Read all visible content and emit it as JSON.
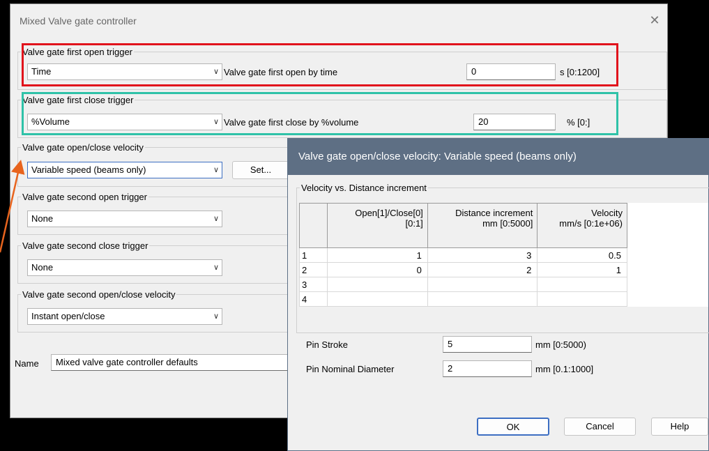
{
  "main_dialog": {
    "title": "Mixed Valve gate controller",
    "close_glyph": "✕",
    "groups": {
      "first_open": {
        "legend": "Valve gate first open trigger",
        "combo": "Time",
        "param_label": "Valve gate first open by time",
        "param_value": "0",
        "unit": "s [0:1200]"
      },
      "first_close": {
        "legend": "Valve gate first close trigger",
        "combo": "%Volume",
        "param_label": "Valve gate first close by %volume",
        "param_value": "20",
        "unit": "% [0:]"
      },
      "velocity": {
        "legend": "Valve gate open/close velocity",
        "combo": "Variable speed (beams only)",
        "set_button": "Set..."
      },
      "second_open": {
        "legend": "Valve gate second open trigger",
        "combo": "None"
      },
      "second_close": {
        "legend": "Valve gate second close trigger",
        "combo": "None"
      },
      "second_velocity": {
        "legend": "Valve gate second open/close velocity",
        "combo": "Instant open/close"
      }
    },
    "name_label": "Name",
    "name_value": "Mixed valve gate controller defaults"
  },
  "sub_dialog": {
    "title": "Valve gate open/close velocity: Variable speed (beams only)",
    "group_legend": "Velocity vs. Distance increment",
    "table": {
      "headers": [
        {
          "line1": "Open[1]/Close[0]",
          "line2": "[0:1]"
        },
        {
          "line1": "Distance increment",
          "line2": "mm [0:5000]"
        },
        {
          "line1": "Velocity",
          "line2": "mm/s [0:1e+06)"
        }
      ],
      "rows": [
        {
          "n": "1",
          "c1": "1",
          "c2": "3",
          "c3": "0.5"
        },
        {
          "n": "2",
          "c1": "0",
          "c2": "2",
          "c3": "1"
        },
        {
          "n": "3",
          "c1": "",
          "c2": "",
          "c3": ""
        },
        {
          "n": "4",
          "c1": "",
          "c2": "",
          "c3": ""
        }
      ]
    },
    "pin_stroke_label": "Pin Stroke",
    "pin_stroke_value": "5",
    "pin_stroke_unit": "mm [0:5000)",
    "pin_diameter_label": "Pin Nominal Diameter",
    "pin_diameter_value": "2",
    "pin_diameter_unit": "mm [0.1:1000]",
    "ok": "OK",
    "cancel": "Cancel",
    "help": "Help"
  },
  "colors": {
    "highlight_red": "#e1131c",
    "highlight_teal": "#2fc2a8",
    "arrow_orange": "#e8641e",
    "sub_titlebar": "#5e6f84"
  },
  "icons": {
    "dropdown": "chevron-down-icon",
    "close": "close-icon"
  }
}
